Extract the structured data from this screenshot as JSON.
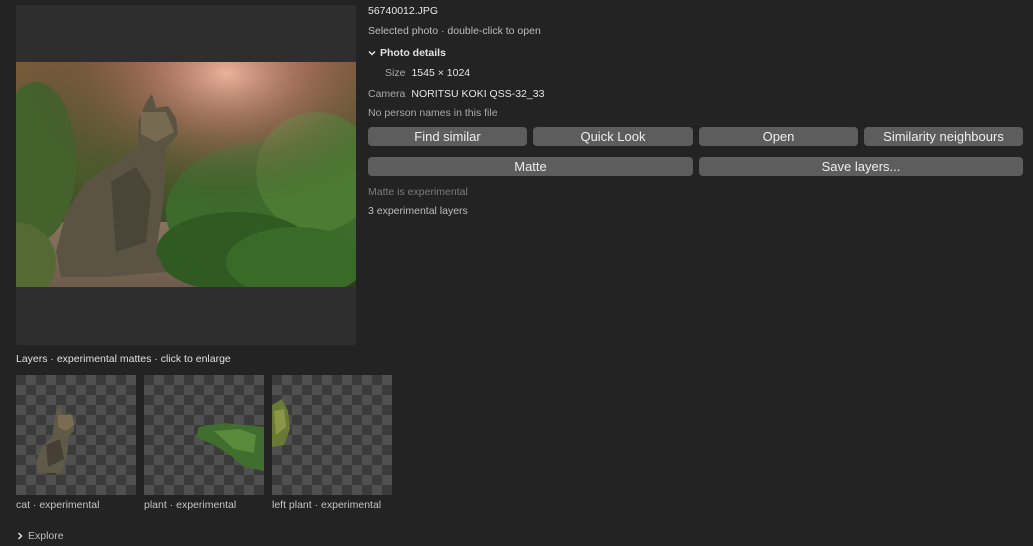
{
  "file": {
    "name": "56740012.JPG",
    "hint": "Selected photo · double-click to open"
  },
  "details": {
    "toggle_label": "Photo details",
    "size_label": "Size",
    "size_value": "1545 × 1024",
    "camera_label": "Camera",
    "camera_value": "NORITSU KOKI QSS-32_33",
    "person_note": "No person names in this file"
  },
  "actions": {
    "find_similar": "Find similar",
    "quick_look": "Quick Look",
    "open": "Open",
    "similarity_neighbours": "Similarity neighbours",
    "matte": "Matte",
    "save_layers": "Save layers..."
  },
  "notes": {
    "matte_experimental": "Matte is experimental",
    "layer_count": "3 experimental layers"
  },
  "layers": {
    "title": "Layers · experimental mattes · click to enlarge",
    "items": [
      {
        "label": "cat · experimental"
      },
      {
        "label": "plant · experimental"
      },
      {
        "label": "left plant · experimental"
      }
    ]
  },
  "explore_label": "Explore",
  "colors": {
    "background": "#232323",
    "button": "#5d5d5d",
    "panel": "#2e2e2e"
  }
}
